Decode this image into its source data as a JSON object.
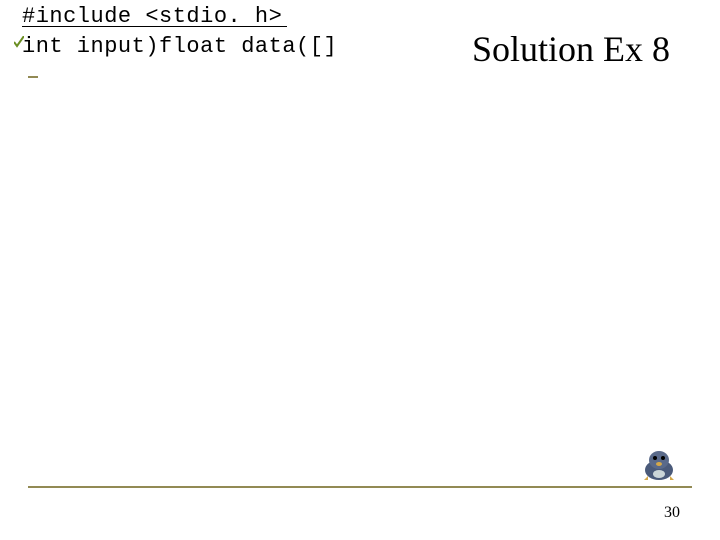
{
  "slide": {
    "title": "Solution Ex 8",
    "code_line_1": "#include <stdio. h>",
    "code_line_2": "int input)float data([]",
    "page_number": "30"
  }
}
